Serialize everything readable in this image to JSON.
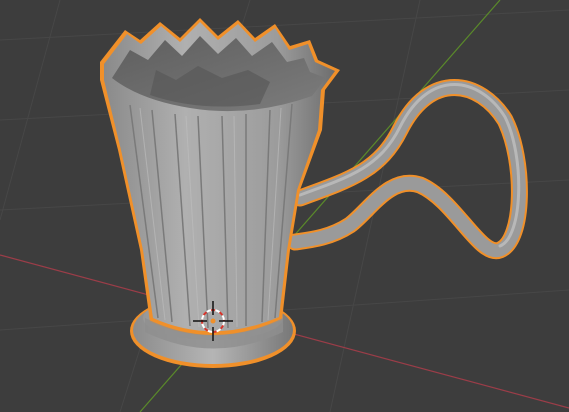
{
  "viewport": {
    "background": "#3d3d3d",
    "grid_color": "#474747",
    "axis_x_color": "#9b3d48",
    "axis_y_color": "#5a8a2a",
    "object_name": "cup-mesh",
    "object_selected": true,
    "selection_outline_color": "#f0902a",
    "mesh_color": "#a6a6a6",
    "mesh_shadow_color": "#6b6b6b",
    "cursor_colors": [
      "#ffffff",
      "#d9342b"
    ]
  }
}
